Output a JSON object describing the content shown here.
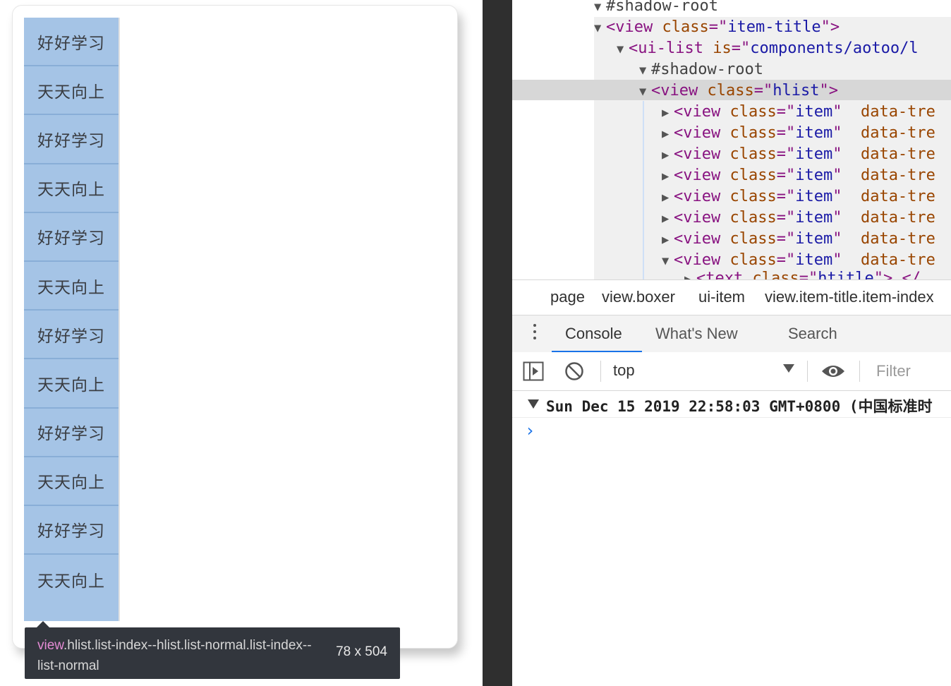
{
  "simulator": {
    "hlist_items": [
      "好好学习",
      "天天向上",
      "好好学习",
      "天天向上",
      "好好学习",
      "天天向上",
      "好好学习",
      "天天向上",
      "好好学习",
      "天天向上",
      "好好学习",
      "天天向上"
    ],
    "tooltip": {
      "tag": "view",
      "selector": ".hlist.list-index--hlist.list-normal.list-index--list-normal",
      "size": "78 x 504"
    },
    "colors": {
      "hlist_bg": "#a5c4e6",
      "tooltip_bg": "#32363d",
      "tag_color": "#e48bd4"
    }
  },
  "devtools": {
    "elements_tree": [
      {
        "tri": "▼",
        "text": "#shadow-root"
      },
      {
        "tri": "▼",
        "tag": "view",
        "attr": "class",
        "value": "item-title",
        "close": ">"
      },
      {
        "tri": "▼",
        "tag": "ui-list",
        "attr": "is",
        "value": "components/aotoo/l"
      },
      {
        "tri": "▼",
        "text": "#shadow-root"
      },
      {
        "tri": "▼",
        "tag": "view",
        "attr": "class",
        "value": "hlist",
        "close": ">"
      },
      {
        "tri": "▶",
        "tag": "view",
        "attr": "class",
        "value": "item",
        "attr2": "data-tre"
      },
      {
        "tri": "▶",
        "tag": "view",
        "attr": "class",
        "value": "item",
        "attr2": "data-tre"
      },
      {
        "tri": "▶",
        "tag": "view",
        "attr": "class",
        "value": "item",
        "attr2": "data-tre"
      },
      {
        "tri": "▶",
        "tag": "view",
        "attr": "class",
        "value": "item",
        "attr2": "data-tre"
      },
      {
        "tri": "▶",
        "tag": "view",
        "attr": "class",
        "value": "item",
        "attr2": "data-tre"
      },
      {
        "tri": "▶",
        "tag": "view",
        "attr": "class",
        "value": "item",
        "attr2": "data-tre"
      },
      {
        "tri": "▶",
        "tag": "view",
        "attr": "class",
        "value": "item",
        "attr2": "data-tre"
      },
      {
        "tri": "▼",
        "tag": "view",
        "attr": "class",
        "value": "item",
        "attr2": "data-tre"
      },
      {
        "tri": "▶",
        "tag": "text",
        "attr": "class",
        "value": "htitle",
        "close": ">",
        "tail": "</"
      }
    ],
    "breadcrumbs": [
      "page",
      "view.boxer",
      "ui-item",
      "view.item-title.item-index"
    ],
    "drawer_tabs": [
      "Console",
      "What's New",
      "Search"
    ],
    "console_toolbar": {
      "context": "top",
      "filter_placeholder": "Filter"
    },
    "console_log": "Sun Dec 15 2019 22:58:03 GMT+0800 (中国标准时",
    "prompt_symbol": "›"
  }
}
